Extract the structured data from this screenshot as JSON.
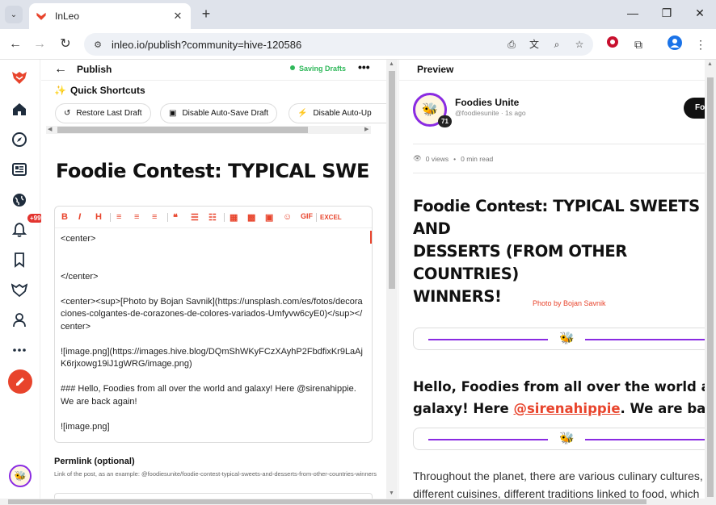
{
  "browser": {
    "tab_title": "InLeo",
    "url": "inleo.io/publish?community=hive-120586"
  },
  "sidebar": {
    "notification_count": "+99"
  },
  "editor": {
    "header_title": "Publish",
    "saving_status": "Saving Drafts",
    "quick_shortcuts_title": "Quick Shortcuts",
    "shortcuts": [
      {
        "label": "Restore Last Draft"
      },
      {
        "label": "Disable Auto-Save Draft"
      },
      {
        "label": "Disable Auto-Up"
      }
    ],
    "post_title": "Foodie Contest:  TYPICAL SWEE",
    "toolbar": {
      "gif_label": "GIF",
      "excel_label": "EXCEL"
    },
    "body_text": "<center>\n\n\n</center>\n\n<center><sup>[Photo by Bojan Savnik](https://unsplash.com/es/fotos/decoraciones-colgantes-de-corazones-de-colores-variados-Umfyvw6cyE0)</sup></center>\n\n![image.png](https://images.hive.blog/DQmShWKyFCzXAyhP2FbdfixKr9LaAjK6rjxowg19iJ1gWRG/image.png)\n\n### Hello, Foodies from all over the world and galaxy! Here @sirenahippie. We are back again!\n\n![image.png]",
    "permalink_label": "Permlink (optional)",
    "permalink_help": "Link of the post, as an example: @foodiesunite/foodie-contest-typical-sweets-and-desserts-from-other-countries-winners"
  },
  "preview": {
    "header_title": "Preview",
    "author_name": "Foodies Unite",
    "author_meta": "@foodiesunite · 1s ago",
    "reputation": "71",
    "follow_label": "Fo",
    "views": "0 views",
    "read_time": "0 min read",
    "post_title": "Foodie Contest: TYPICAL SWEETS AND\nDESSERTS (FROM OTHER COUNTRIES)\nWINNERS!",
    "photo_credit": "Photo by Bojan Savnik",
    "h3_line1": "Hello, Foodies from all over the world and",
    "h3_line2_prefix": "galaxy! Here ",
    "h3_mention": "@sirenahippie",
    "h3_line2_suffix": ". We are back again!",
    "para_line1": "Throughout the planet, there are various culinary cultures,",
    "para_line2": "different cuisines, different traditions linked to food, which"
  },
  "colors": {
    "accent": "#e8442c",
    "purple": "#8a2be2",
    "saving_green": "#2fb85a"
  }
}
